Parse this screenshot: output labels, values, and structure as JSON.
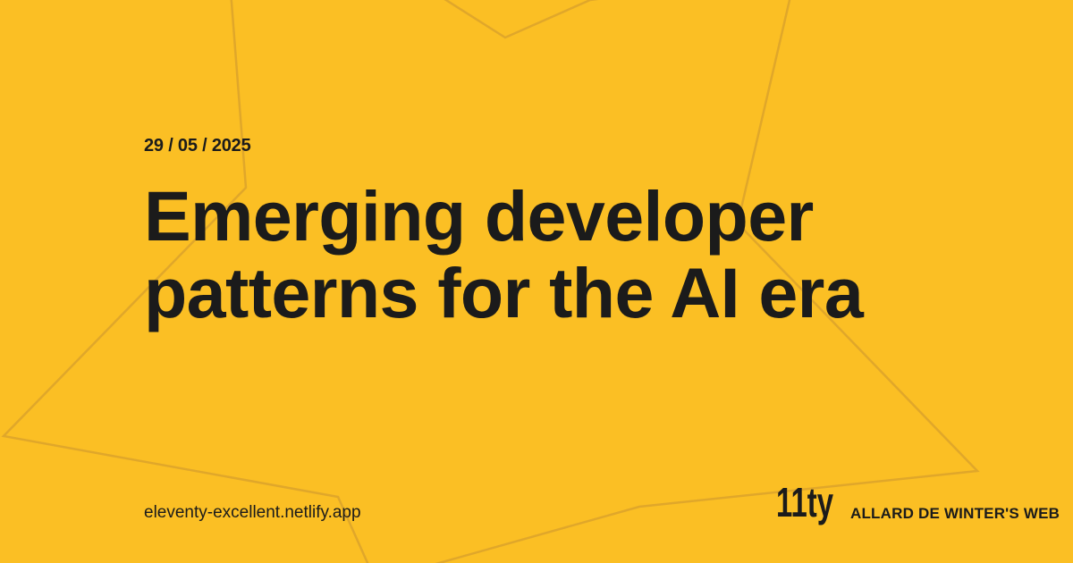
{
  "post": {
    "date": "29 / 05 / 2025",
    "title": "Emerging developer patterns for the AI era"
  },
  "footer": {
    "url": "eleventy-excellent.netlify.app",
    "logo_text": "11ty",
    "site_name": "ALLARD DE WINTER'S WEB"
  },
  "colors": {
    "background": "#fbbf24",
    "text": "#1b1b1b",
    "star_outline": "#e0a72a"
  },
  "icons": {
    "logo": "eleventy-logo-icon",
    "background_decoration": "star-outline-icon"
  }
}
